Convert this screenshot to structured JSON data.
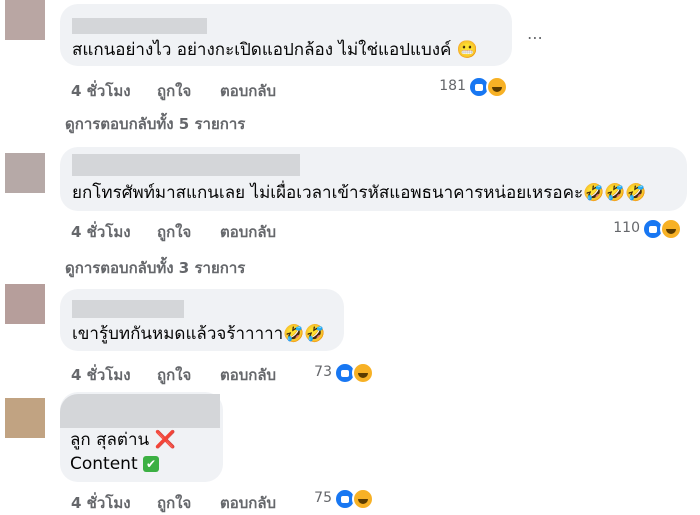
{
  "comments": [
    {
      "text": "สแกนอย่างไว อย่างกะเปิดแอปกล้อง ไม่ใช่แอปแบงค์ 😬",
      "time": "4 ชั่วโมง",
      "like": "ถูกใจ",
      "reply": "ตอบกลับ",
      "count": "181",
      "more": "⋯"
    },
    {
      "text": "ยกโทรศัพท์มาสแกนเลย ไม่เผื่อเวลาเข้ารหัสแอพธนาคารหน่อยเหรอคะ🤣🤣🤣",
      "time": "4 ชั่วโมง",
      "like": "ถูกใจ",
      "reply": "ตอบกลับ",
      "count": "110"
    },
    {
      "text": "เขารู้บทกันหมดแล้วจร้าาาาา🤣🤣",
      "time": "4 ชั่วโมง",
      "like": "ถูกใจ",
      "reply": "ตอบกลับ",
      "count": "73"
    },
    {
      "line1": "ลูก สุลต่าน",
      "line1_icon": "❌",
      "line2": "Content",
      "line2_icon": "✔",
      "time": "4 ชั่วโมง",
      "like": "ถูกใจ",
      "reply": "ตอบกลับ",
      "count": "75"
    }
  ],
  "view_replies": [
    "ดูการตอบกลับทั้ง 5 รายการ",
    "ดูการตอบกลับทั้ง 3 รายการ"
  ],
  "icons": {
    "like": "like-reaction-icon",
    "haha": "haha-reaction-icon",
    "more": "more-options-icon"
  },
  "colors": {
    "bubble": "#f0f2f5",
    "meta_text": "#65676b",
    "like_blue": "#1877f2",
    "haha_yellow": "#f7b125"
  }
}
